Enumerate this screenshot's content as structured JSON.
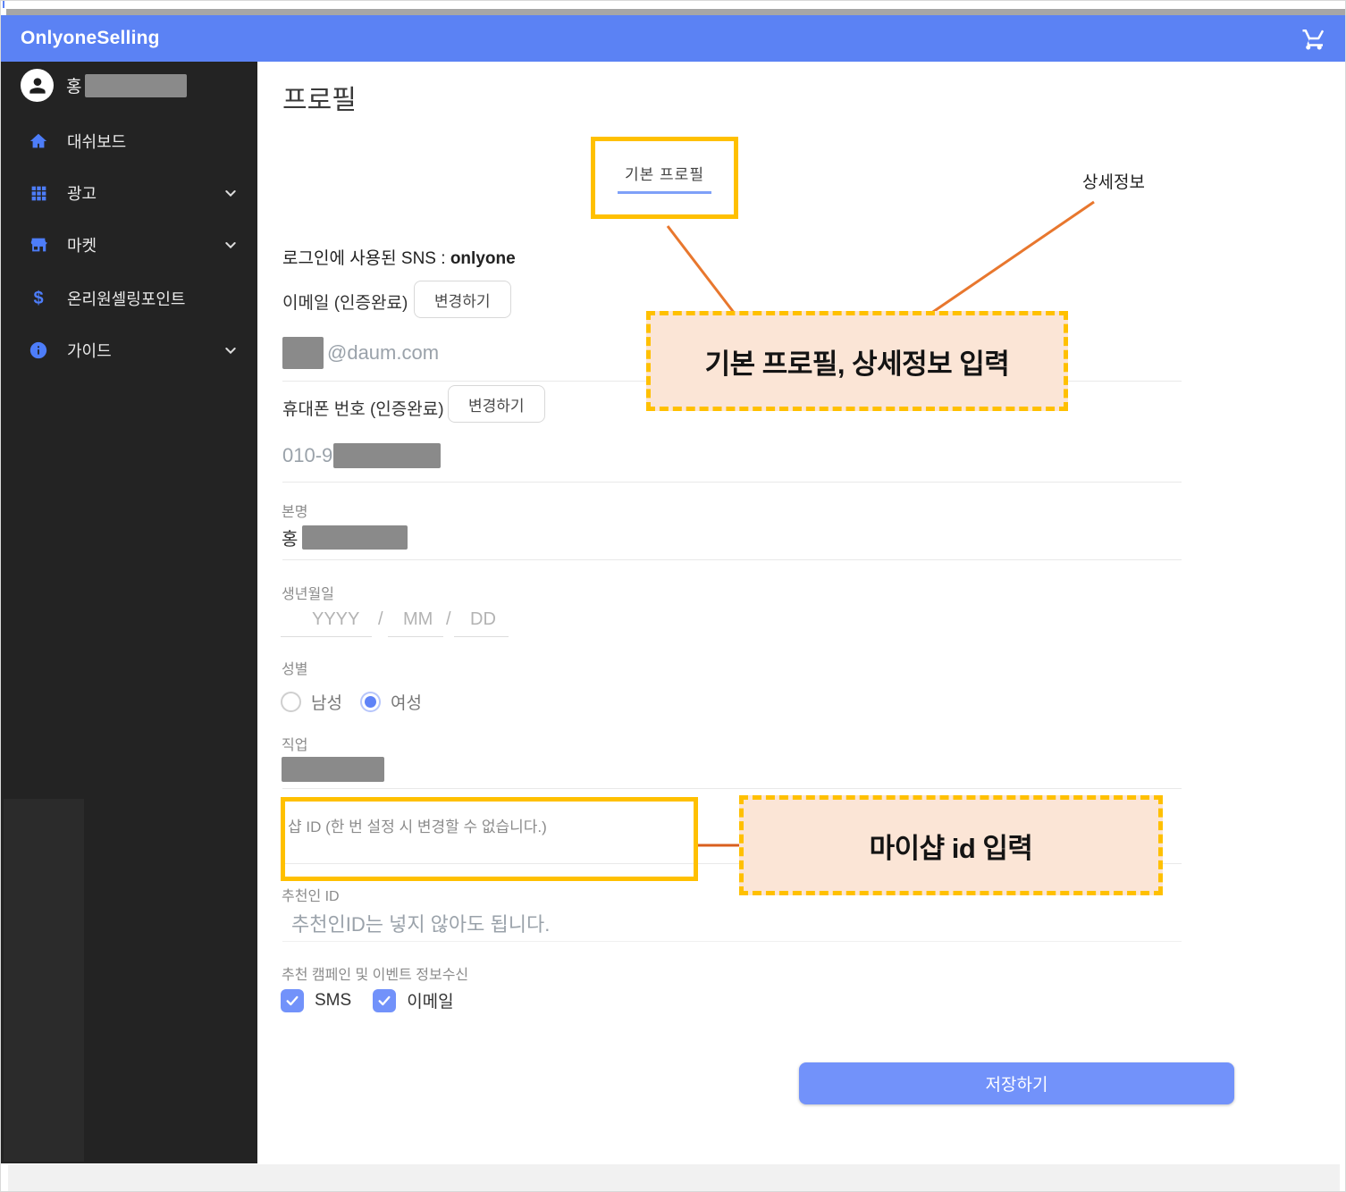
{
  "header": {
    "brand": "OnlyoneSelling"
  },
  "sidebar": {
    "user": {
      "name_visible": "홍"
    },
    "items": [
      {
        "label": "대쉬보드",
        "icon": "home-icon",
        "expandable": false
      },
      {
        "label": "광고",
        "icon": "grid-icon",
        "expandable": true
      },
      {
        "label": "마켓",
        "icon": "store-icon",
        "expandable": true
      },
      {
        "label": "온리원셀링포인트",
        "icon": "dollar-icon",
        "glyph": "$",
        "expandable": false
      },
      {
        "label": "가이드",
        "icon": "info-icon",
        "expandable": true
      }
    ]
  },
  "main": {
    "title": "프로필",
    "tab": {
      "label": "기본 프로필"
    },
    "sns": {
      "label": "로그인에 사용된 SNS : ",
      "value": "onlyone"
    },
    "email": {
      "label": "이메일 (인증완료)",
      "button": "변경하기",
      "value_suffix": "@daum.com"
    },
    "phone": {
      "label": "휴대폰 번호 (인증완료)",
      "button": "변경하기",
      "value_prefix": "010-9"
    },
    "real_name": {
      "label": "본명",
      "value_prefix": "홍"
    },
    "birth": {
      "label": "생년월일",
      "yyyy": "YYYY",
      "mm": "MM",
      "dd": "DD",
      "sep1": "/",
      "sep2": "/"
    },
    "gender": {
      "label": "성별",
      "options": [
        {
          "label": "남성",
          "selected": false
        },
        {
          "label": "여성",
          "selected": true
        }
      ]
    },
    "job": {
      "label": "직업"
    },
    "shop_id": {
      "label": "샵 ID (한 번 설정 시 변경할 수 없습니다.)",
      "value": ""
    },
    "referrer": {
      "label": "추천인 ID",
      "placeholder": "추천인ID는 넣지 않아도 됩니다."
    },
    "subscribe": {
      "label": "추천 캠페인 및 이벤트 정보수신",
      "options": [
        {
          "label": "SMS",
          "checked": true
        },
        {
          "label": "이메일",
          "checked": true
        }
      ]
    },
    "save_button": "저장하기"
  },
  "annotations": {
    "tab_note": "상세정보",
    "note1": "기본 프로필, 상세정보 입력",
    "note2": "마이샵 id 입력"
  },
  "colors": {
    "header-blue": "#5b82f4",
    "control-blue": "#7292fa",
    "icon-blue": "#4d7df9",
    "highlight": "#ffc000",
    "note-fill": "#fbe5d6",
    "connector": "#e8772e",
    "sidebar-bg": "#232323",
    "redact": "#8a8a8a"
  }
}
